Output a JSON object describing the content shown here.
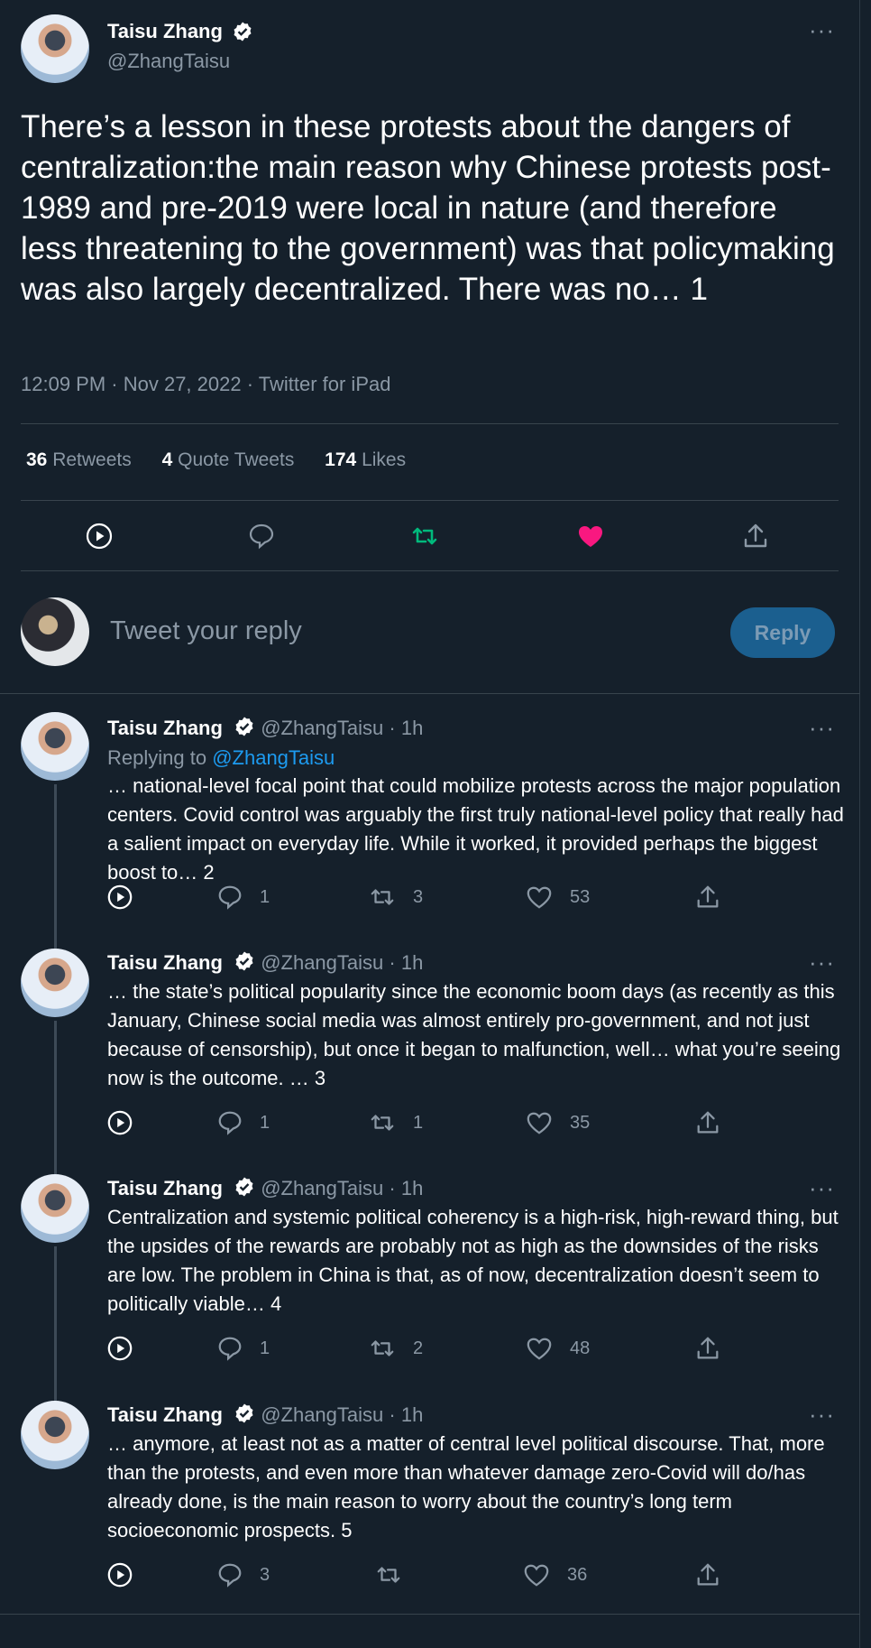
{
  "main_tweet": {
    "author_name": "Taisu Zhang",
    "author_handle": "@ZhangTaisu",
    "text": "There’s a lesson in these protests about the dangers of centralization:the main reason why Chinese protests post-1989 and pre-2019 were local in nature (and therefore less threatening to the government) was that policymaking was also largely decentralized. There was no… 1",
    "meta": "12:09 PM · Nov 27, 2022 · Twitter for iPad",
    "stats": {
      "retweets_count": "36",
      "retweets_label": "Retweets",
      "quotes_count": "4",
      "quotes_label": "Quote Tweets",
      "likes_count": "174",
      "likes_label": "Likes"
    }
  },
  "reply_box": {
    "placeholder": "Tweet your reply",
    "button_label": "Reply"
  },
  "replies": [
    {
      "author_name": "Taisu Zhang",
      "author_handle": "@ZhangTaisu",
      "time": "· 1h",
      "replying_prefix": "Replying to",
      "replying_to": "@ZhangTaisu",
      "text": "… national-level focal point that could mobilize protests across the major population centers. Covid control was arguably the first truly national-level policy that really had a salient impact on everyday life. While it worked, it provided perhaps the biggest boost to… 2",
      "replies": "1",
      "retweets": "3",
      "likes": "53"
    },
    {
      "author_name": "Taisu Zhang",
      "author_handle": "@ZhangTaisu",
      "time": "· 1h",
      "text": "… the state’s political popularity since the economic boom days (as recently as this January, Chinese social media was almost entirely pro-government, and not just because of censorship), but once it began to malfunction, well… what you’re seeing now is the outcome. … 3",
      "replies": "1",
      "retweets": "1",
      "likes": "35"
    },
    {
      "author_name": "Taisu Zhang",
      "author_handle": "@ZhangTaisu",
      "time": "· 1h",
      "text": "Centralization and systemic political coherency is a high-risk, high-reward thing, but the upsides of the rewards are probably not as high as the downsides of the risks are low. The problem in China is that, as of now, decentralization doesn’t seem to politically viable… 4",
      "replies": "1",
      "retweets": "2",
      "likes": "48"
    },
    {
      "author_name": "Taisu Zhang",
      "author_handle": "@ZhangTaisu",
      "time": "· 1h",
      "text": "… anymore, at least not as a matter of central level political discourse. That, more than the protests, and even more than whatever damage zero-Covid will do/has already done, is the main reason to worry about the country’s long term socioeconomic prospects. 5",
      "replies": "3",
      "retweets": "",
      "likes": "36"
    }
  ],
  "colors": {
    "background": "#15202b",
    "retweet_active": "#00ba7c",
    "like_active": "#f91880",
    "link": "#1d9bf0",
    "muted": "#8b98a5"
  },
  "icons": [
    "play-icon",
    "comment-icon",
    "retweet-icon",
    "heart-icon",
    "share-icon",
    "verified-badge-icon",
    "more-icon"
  ]
}
